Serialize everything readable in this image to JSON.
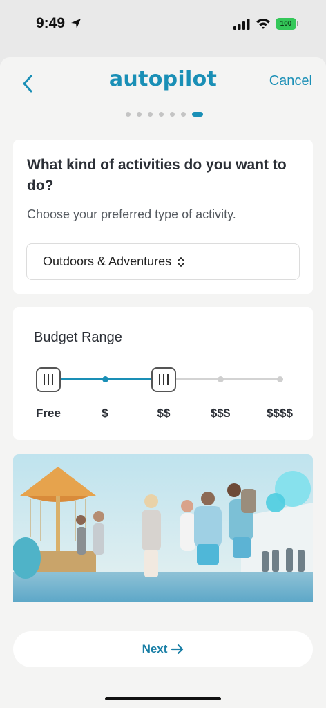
{
  "status_bar": {
    "time": "9:49",
    "battery": "100",
    "icons": [
      "location-arrow-icon",
      "cellular-signal-icon",
      "wifi-icon",
      "battery-icon"
    ]
  },
  "header": {
    "back_icon": "chevron-left-icon",
    "logo": "autopilot",
    "cancel_label": "Cancel"
  },
  "progress": {
    "total_steps": 7,
    "current_step": 7
  },
  "activity": {
    "question": "What kind of activities do you want to do?",
    "subtitle": "Choose your preferred type of activity.",
    "selected": "Outdoors & Adventures",
    "select_icon": "chevron-up-down-icon"
  },
  "budget": {
    "title": "Budget Range",
    "levels": [
      "Free",
      "$",
      "$$",
      "$$$",
      "$$$$"
    ],
    "range_min_index": 0,
    "range_max_index": 2
  },
  "footer": {
    "next_label": "Next",
    "next_icon": "arrow-right-icon"
  },
  "colors": {
    "accent": "#1a8fb6",
    "background": "#f4f4f3",
    "card": "#ffffff"
  }
}
